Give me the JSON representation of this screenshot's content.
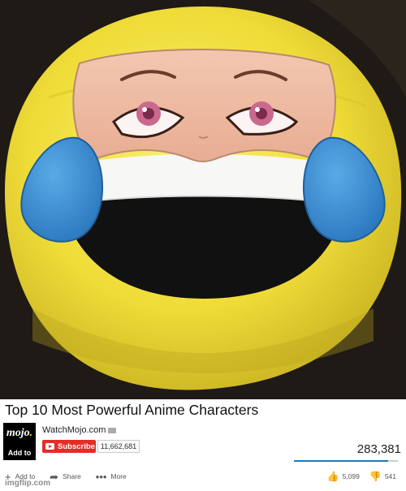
{
  "video": {
    "title": "Top 10 Most Powerful Anime Characters",
    "view_count": "283,381",
    "like_ratio": 0.91
  },
  "channel": {
    "name": "WatchMojo.com",
    "logo_text": "mojo",
    "logo_add_label": "Add to",
    "subscribe_label": "Subscribe",
    "subscriber_count": "11,662,681"
  },
  "actions": {
    "add_to_label": "Add to",
    "share_label": "Share",
    "more_label": "More"
  },
  "rating": {
    "likes": "5,099",
    "dislikes": "541"
  },
  "watermark": "imgflip.com",
  "colors": {
    "subscribe_red": "#e52d27",
    "like_bar_blue": "#167ac6",
    "pillow_yellow": "#f2e23a",
    "tear_blue": "#3a8fd8"
  },
  "icons": {
    "add": "plus-icon",
    "share": "share-arrow-icon",
    "more": "more-dots-icon",
    "like": "thumbs-up-icon",
    "dislike": "thumbs-down-icon"
  }
}
